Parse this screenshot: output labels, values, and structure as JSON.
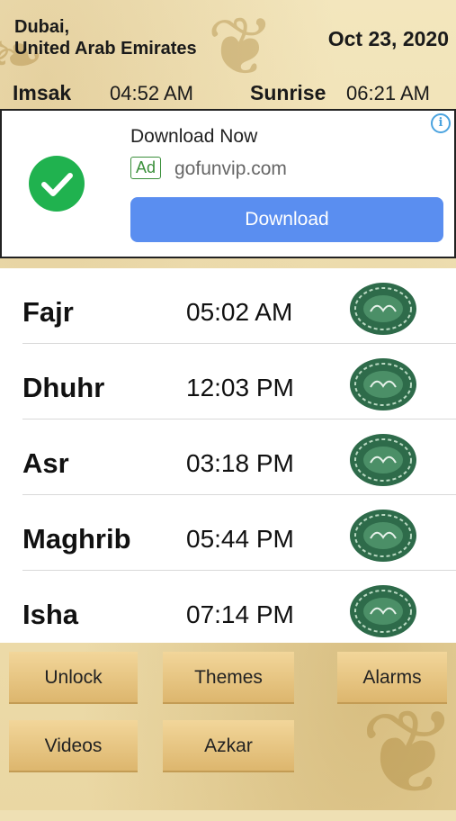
{
  "header": {
    "city_line1": "Dubai,",
    "city_line2": "United Arab Emirates",
    "date": "Oct 23, 2020",
    "imsak_label": "Imsak",
    "imsak_time": "04:52 AM",
    "sunrise_label": "Sunrise",
    "sunrise_time": "06:21 AM"
  },
  "ad": {
    "title": "Download Now",
    "badge": "Ad",
    "url": "gofunvip.com",
    "button": "Download",
    "info_icon": "info-icon",
    "check_icon": "check-icon"
  },
  "prayers": [
    {
      "name": "Fajr",
      "time": "05:02 AM"
    },
    {
      "name": "Dhuhr",
      "time": "12:03 PM"
    },
    {
      "name": "Asr",
      "time": "03:18 PM"
    },
    {
      "name": "Maghrib",
      "time": "05:44 PM"
    },
    {
      "name": "Isha",
      "time": "07:14 PM"
    }
  ],
  "buttons": {
    "unlock": "Unlock",
    "themes": "Themes",
    "alarms": "Alarms",
    "videos": "Videos",
    "azkar": "Azkar"
  },
  "colors": {
    "accent": "#5a8ef0",
    "check": "#20b24f",
    "emblem": "#2e6b4a"
  }
}
